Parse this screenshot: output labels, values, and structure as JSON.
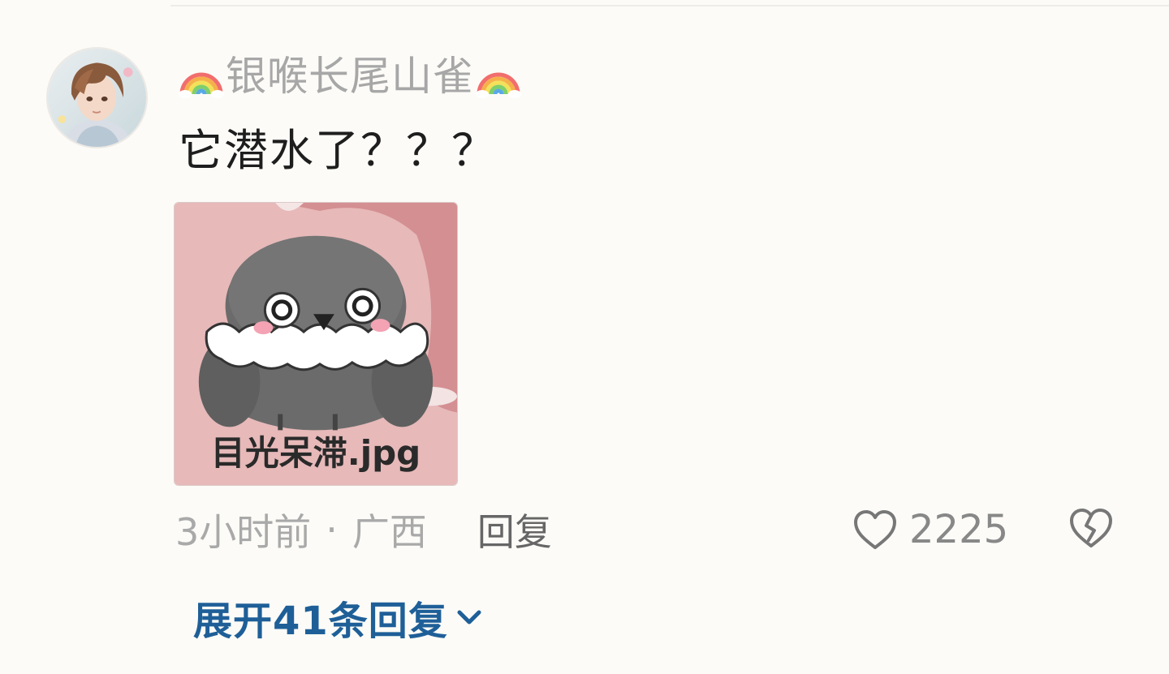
{
  "comment": {
    "username": "银喉长尾山雀",
    "username_icon": "rainbow-emoji",
    "text": "它潜水了？？？",
    "sticker_caption": "目光呆滞.jpg",
    "time": "3小时前",
    "separator": "·",
    "location": "广西",
    "reply_label": "回复",
    "like_count": "2225",
    "expand_label": "展开41条回复"
  },
  "colors": {
    "username": "#a7a7a7",
    "meta": "#a9a9a9",
    "link": "#1f5f98",
    "sticker_bg": "#e7b9b9"
  },
  "icons": {
    "like": "heart-outline-icon",
    "dislike": "broken-heart-icon",
    "expand": "chevron-down-icon"
  }
}
